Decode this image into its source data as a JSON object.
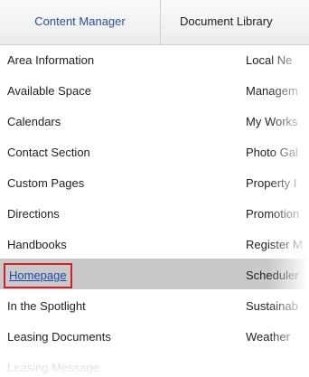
{
  "tabs": [
    {
      "label": "Content Manager"
    },
    {
      "label": "Document Library"
    }
  ],
  "left_menu": [
    "Area Information",
    "Available Space",
    "Calendars",
    "Contact Section",
    "Custom Pages",
    "Directions",
    "Handbooks",
    "Homepage",
    "In the Spotlight",
    "Leasing Documents",
    "Leasing Message"
  ],
  "right_menu": [
    "Local Ne",
    "Managem",
    "My Works",
    "Photo Gal",
    "Property I",
    "Promotion",
    "Register M",
    "Scheduler",
    "Sustainab",
    "Weather"
  ],
  "highlight": {
    "color": "#d21f2a",
    "row_bg": "#c9c9c9",
    "link_color": "#1f49a8"
  }
}
